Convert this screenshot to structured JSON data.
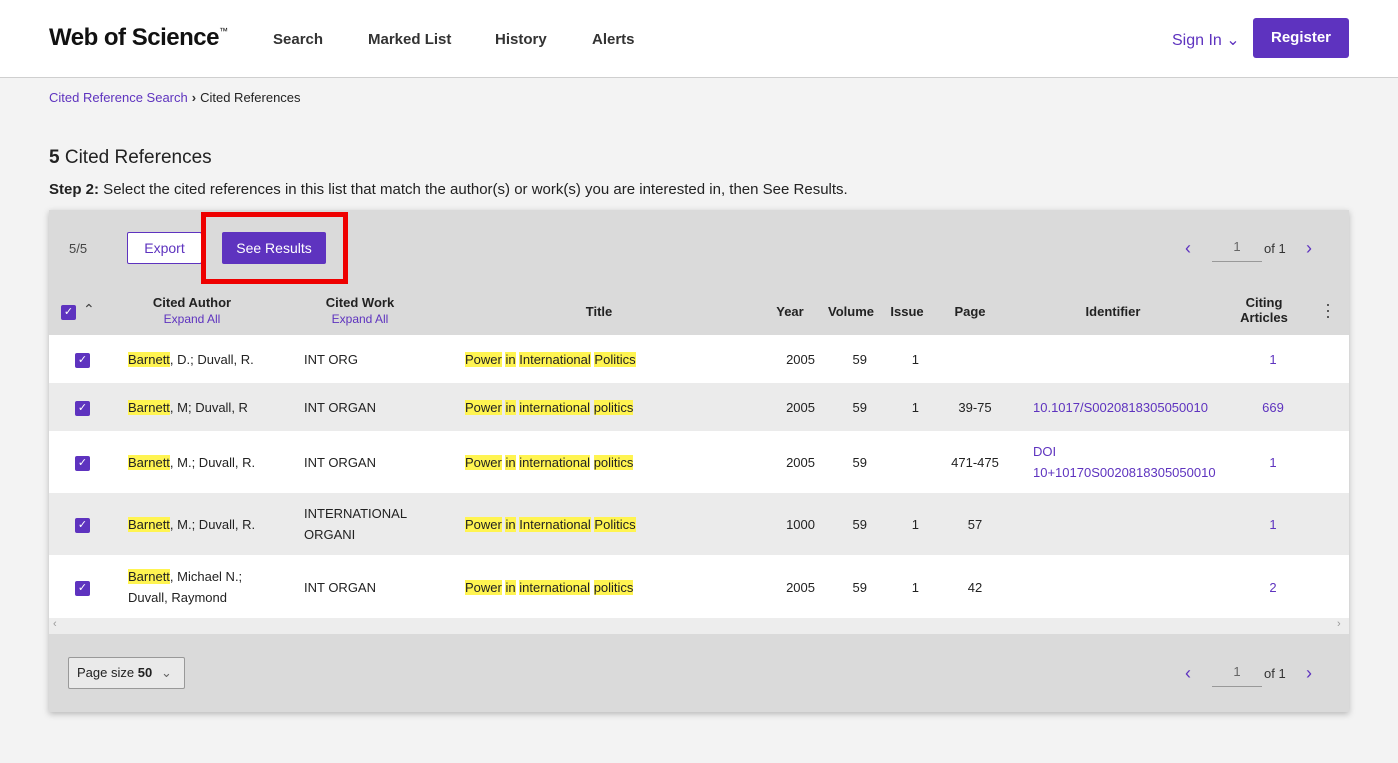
{
  "header": {
    "logo_text": "Web of Science",
    "logo_tm": "™",
    "nav": [
      "Search",
      "Marked List",
      "History",
      "Alerts"
    ],
    "sign_in": "Sign In ⌄",
    "register": "Register"
  },
  "breadcrumb": {
    "parent": "Cited Reference Search",
    "separator": "›",
    "current": "Cited References"
  },
  "title": {
    "count": "5",
    "text": " Cited References"
  },
  "step": {
    "label": "Step 2:",
    "text": " Select the cited references in this list that match the author(s) or work(s) you are interested in, then See Results."
  },
  "toolbar": {
    "count": "5/5",
    "export": "Export",
    "see_results": "See Results",
    "page": "1",
    "of": "of 1"
  },
  "columns": {
    "cited_author": "Cited Author",
    "cited_work": "Cited Work",
    "expand_all": "Expand All",
    "title": "Title",
    "year": "Year",
    "volume": "Volume",
    "issue": "Issue",
    "page": "Page",
    "identifier": "Identifier",
    "citing": "Citing",
    "articles": "Articles"
  },
  "rows": [
    {
      "author_hl": "Barnett",
      "author_rest": ", D.; Duvall, R.",
      "author_line2": "",
      "work": "INT ORG",
      "work_line2": "",
      "title": [
        "Power",
        "in",
        "International",
        "Politics"
      ],
      "year": "2005",
      "volume": "59",
      "issue": "1",
      "page": "",
      "identifier": "",
      "identifier_line2": "",
      "citing": "1",
      "checked": true
    },
    {
      "author_hl": "Barnett",
      "author_rest": ", M; Duvall, R",
      "author_line2": "",
      "work": "INT ORGAN",
      "work_line2": "",
      "title": [
        "Power",
        "in",
        "international",
        "politics"
      ],
      "year": "2005",
      "volume": "59",
      "issue": "1",
      "page": "39-75",
      "identifier": "10.1017/S0020818305050010",
      "identifier_line2": "",
      "citing": "669",
      "checked": true
    },
    {
      "author_hl": "Barnett",
      "author_rest": ", M.; Duvall, R.",
      "author_line2": "",
      "work": "INT ORGAN",
      "work_line2": "",
      "title": [
        "Power",
        "in",
        "international",
        "politics"
      ],
      "year": "2005",
      "volume": "59",
      "issue": "",
      "page": "471-475",
      "identifier": "DOI",
      "identifier_line2": "10+10170S0020818305050010",
      "citing": "1",
      "checked": true
    },
    {
      "author_hl": "Barnett",
      "author_rest": ", M.; Duvall, R.",
      "author_line2": "",
      "work": "INTERNATIONAL",
      "work_line2": "ORGANI",
      "title": [
        "Power",
        "in",
        "International",
        "Politics"
      ],
      "year": "1000",
      "volume": "59",
      "issue": "1",
      "page": "57",
      "identifier": "",
      "identifier_line2": "",
      "citing": "1",
      "checked": true
    },
    {
      "author_hl": "Barnett",
      "author_rest": ", Michael N.;",
      "author_line2": "Duvall, Raymond",
      "work": "INT ORGAN",
      "work_line2": "",
      "title": [
        "Power",
        "in",
        "international",
        "politics"
      ],
      "year": "2005",
      "volume": "59",
      "issue": "1",
      "page": "42",
      "identifier": "",
      "identifier_line2": "",
      "citing": "2",
      "checked": true
    }
  ],
  "footer": {
    "page_size_label": "Page size",
    "page_size_value": "50",
    "page": "1",
    "of": "of 1"
  },
  "colors": {
    "accent": "#5e33bf",
    "highlight": "#fff451",
    "callout": "#ee0000"
  }
}
